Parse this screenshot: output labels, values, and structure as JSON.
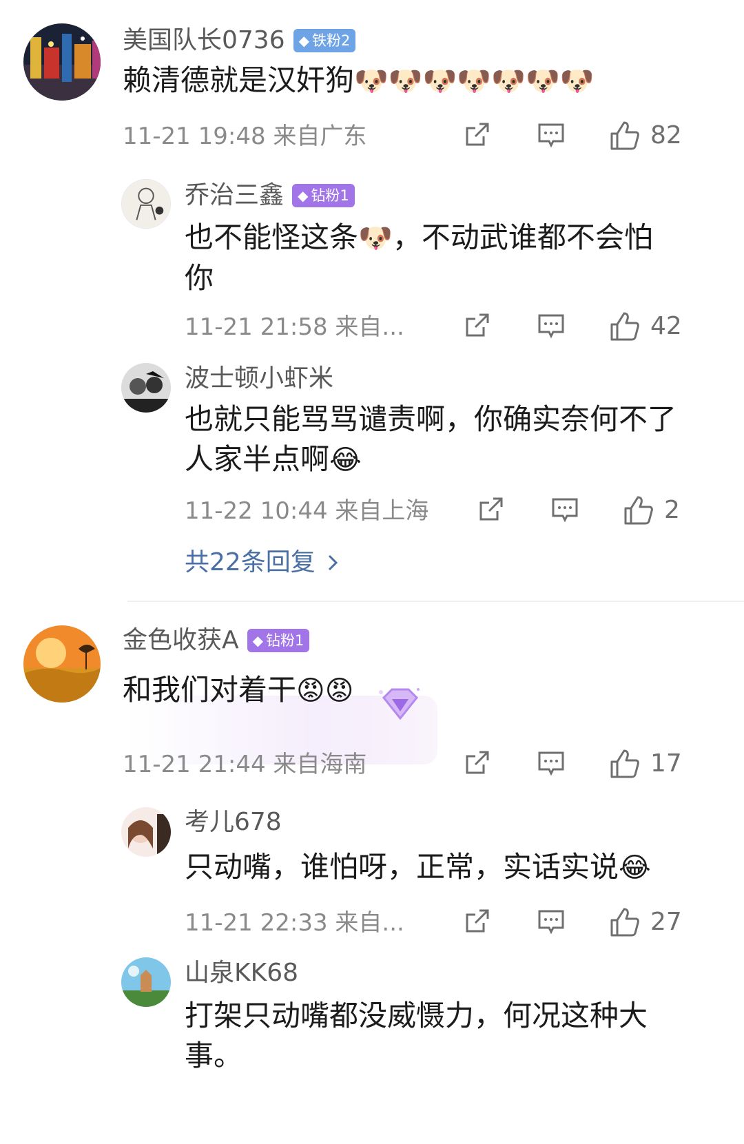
{
  "comments": [
    {
      "username": "美国队长0736",
      "badge": "铁粉2",
      "content": "赖清德就是汉奸狗",
      "emoji": "🐶🐶🐶🐶🐶🐶🐶",
      "time": "11-21 19:48",
      "location": "来自广东",
      "likes": "82",
      "replies": [
        {
          "username": "乔治三鑫",
          "badge": "钻粉1",
          "content_a": "也不能怪这条",
          "emoji": "🐶",
          "content_b": "，不动武谁都不会怕你",
          "time": "11-21 21:58",
          "location": "来自...",
          "likes": "42"
        },
        {
          "username": "波士顿小虾米",
          "content": "也就只能骂骂谴责啊，你确实奈何不了人家半点啊",
          "emoji": "😂",
          "time": "11-22 10:44",
          "location": "来自上海",
          "likes": "2"
        }
      ],
      "more_replies": "共22条回复"
    },
    {
      "username": "金色收获A",
      "badge": "钻粉1",
      "content": "和我们对着干",
      "emoji": "😡😡",
      "time": "11-21 21:44",
      "location": "来自海南",
      "likes": "17",
      "replies": [
        {
          "username": "考儿678",
          "content": "只动嘴，谁怕呀，正常，实话实说",
          "emoji": "😂",
          "time": "11-21 22:33",
          "location": "来自...",
          "likes": "27"
        },
        {
          "username": "山泉KK68",
          "content": "打架只动嘴都没威慑力，何况这种大事。"
        }
      ]
    }
  ],
  "icons": {
    "share": "share-icon",
    "comment": "comment-icon",
    "like": "thumb-up-icon",
    "chevron": "chevron-right-icon",
    "gem": "diamond-icon"
  },
  "colors": {
    "iron_badge": "#6ea4e6",
    "diamond_badge": "#a174e8",
    "link": "#4a6fa5"
  }
}
